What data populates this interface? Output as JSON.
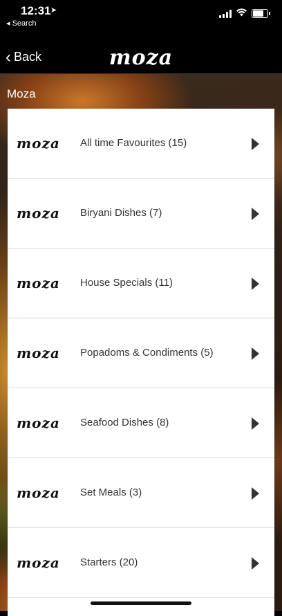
{
  "status_bar": {
    "time": "12:31",
    "back_app": "◂ Search",
    "location_icon": "location-arrow-icon"
  },
  "nav": {
    "back_label": "Back",
    "logo": "moza"
  },
  "section": {
    "title": "Moza"
  },
  "categories": [
    {
      "logo": "moza",
      "label": "All time Favourites (15)"
    },
    {
      "logo": "moza",
      "label": "Biryani Dishes (7)"
    },
    {
      "logo": "moza",
      "label": "House Specials (11)"
    },
    {
      "logo": "moza",
      "label": "Popadoms & Condiments (5)"
    },
    {
      "logo": "moza",
      "label": "Seafood Dishes (8)"
    },
    {
      "logo": "moza",
      "label": "Set Meals (3)"
    },
    {
      "logo": "moza",
      "label": "Starters (20)"
    }
  ]
}
